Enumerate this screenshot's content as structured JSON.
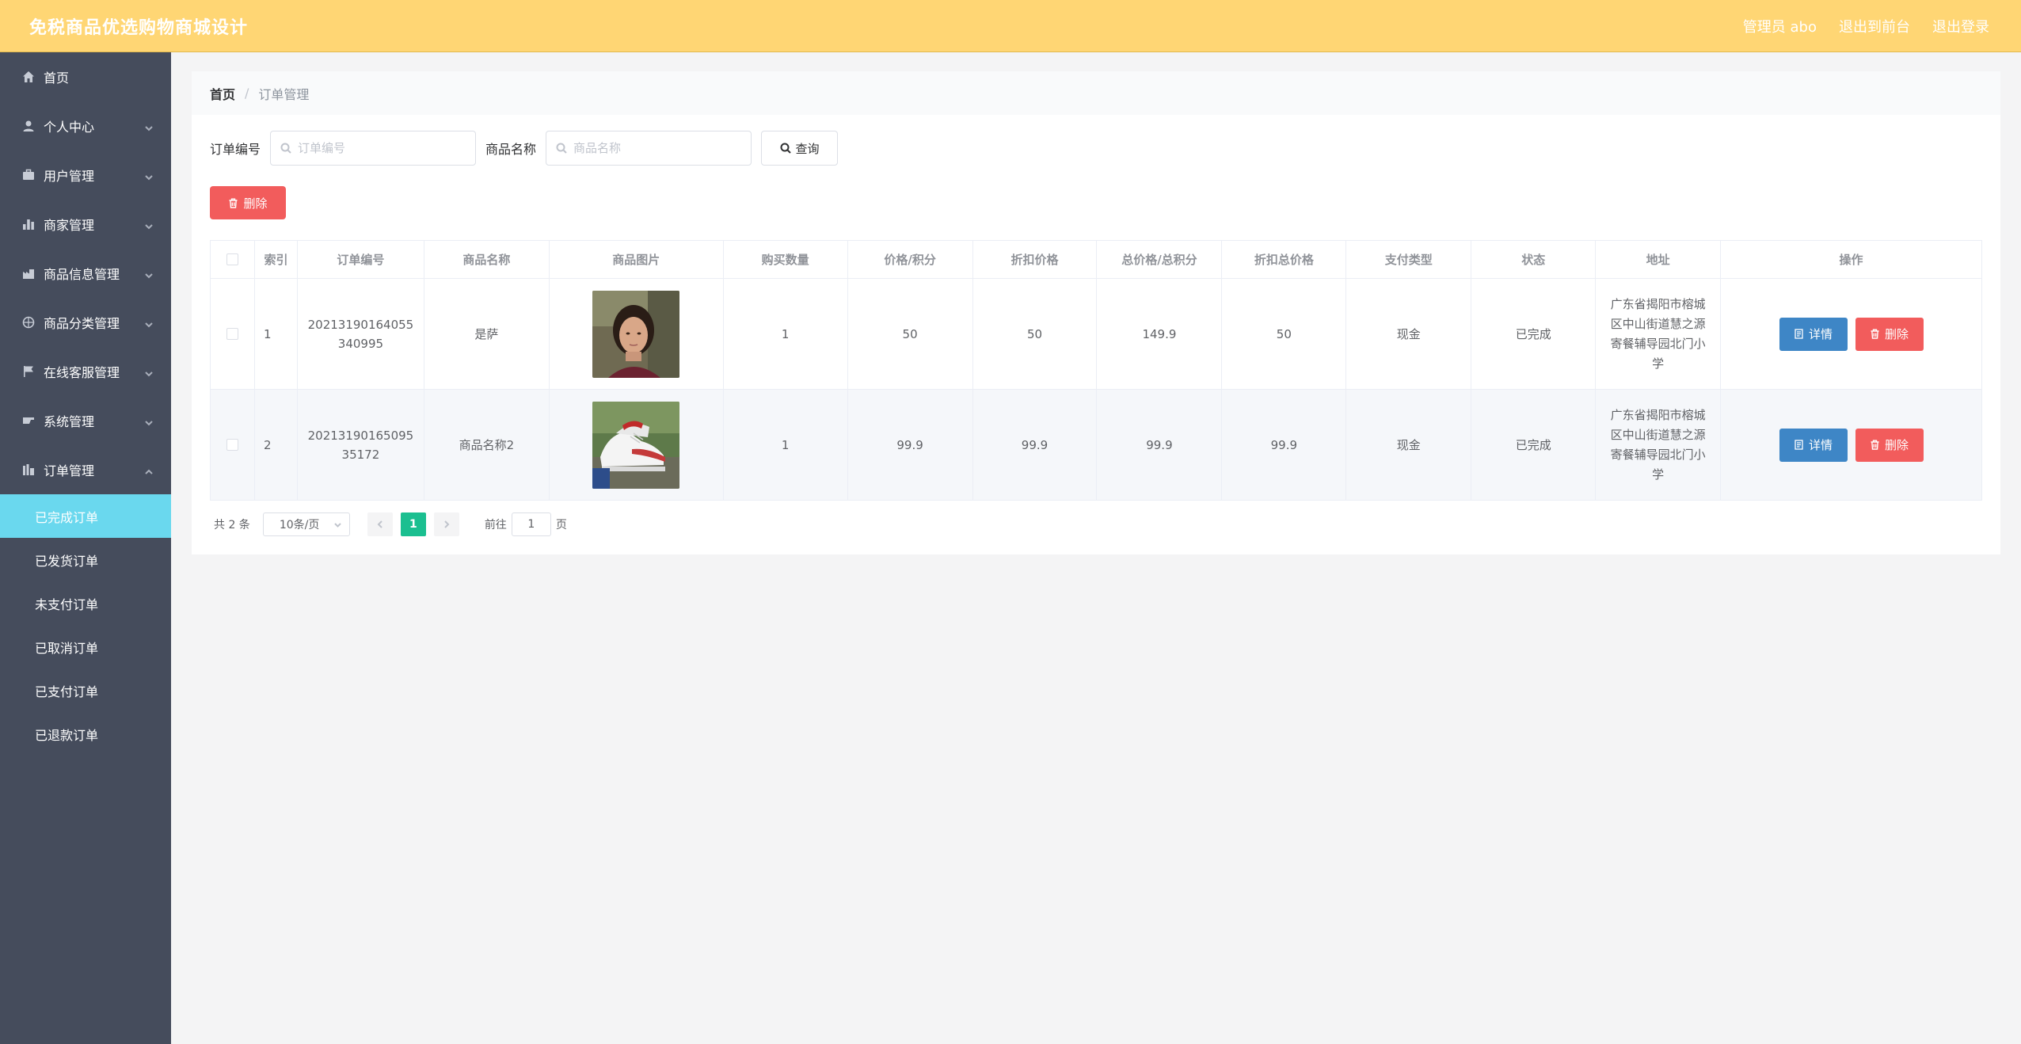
{
  "header": {
    "title": "免税商品优选购物商城设计",
    "admin_label": "管理员 abo",
    "back_to_front": "退出到前台",
    "logout": "退出登录"
  },
  "sidebar": {
    "items": [
      {
        "label": "首页",
        "icon": "home-icon"
      },
      {
        "label": "个人中心",
        "icon": "user-icon"
      },
      {
        "label": "用户管理",
        "icon": "briefcase-icon"
      },
      {
        "label": "商家管理",
        "icon": "bar-chart-icon"
      },
      {
        "label": "商品信息管理",
        "icon": "factory-icon"
      },
      {
        "label": "商品分类管理",
        "icon": "compass-icon"
      },
      {
        "label": "在线客服管理",
        "icon": "flag-icon"
      },
      {
        "label": "系统管理",
        "icon": "settings-icon"
      },
      {
        "label": "订单管理",
        "icon": "orders-icon"
      }
    ],
    "submenu": [
      {
        "label": "已完成订单"
      },
      {
        "label": "已发货订单"
      },
      {
        "label": "未支付订单"
      },
      {
        "label": "已取消订单"
      },
      {
        "label": "已支付订单"
      },
      {
        "label": "已退款订单"
      }
    ]
  },
  "breadcrumb": {
    "home": "首页",
    "separator": "/",
    "current": "订单管理"
  },
  "search": {
    "order_no_label": "订单编号",
    "order_no_placeholder": "订单编号",
    "product_name_label": "商品名称",
    "product_name_placeholder": "商品名称",
    "query_button": "查询"
  },
  "toolbar": {
    "delete_button": "删除"
  },
  "table": {
    "headers": [
      "索引",
      "订单编号",
      "商品名称",
      "商品图片",
      "购买数量",
      "价格/积分",
      "折扣价格",
      "总价格/总积分",
      "折扣总价格",
      "支付类型",
      "状态",
      "地址",
      "操作"
    ],
    "rows": [
      {
        "index": "1",
        "order_no": "20213190164055340995",
        "product_name": "是萨",
        "image": "portrait-photo",
        "quantity": "1",
        "price": "50",
        "discount_price": "50",
        "total_price": "149.9",
        "discount_total": "50",
        "pay_type": "现金",
        "status": "已完成",
        "address": "广东省揭阳市榕城区中山街道慧之源寄餐辅导园北门小学",
        "detail_button": "详情",
        "delete_button": "删除"
      },
      {
        "index": "2",
        "order_no": "2021319016509535172",
        "product_name": "商品名称2",
        "image": "sneaker-photo",
        "quantity": "1",
        "price": "99.9",
        "discount_price": "99.9",
        "total_price": "99.9",
        "discount_total": "99.9",
        "pay_type": "现金",
        "status": "已完成",
        "address": "广东省揭阳市榕城区中山街道慧之源寄餐辅导园北门小学",
        "detail_button": "详情",
        "delete_button": "删除"
      }
    ]
  },
  "pagination": {
    "total": "共 2 条",
    "page_size": "10条/页",
    "current_page": "1",
    "goto_prefix": "前往",
    "goto_value": "1",
    "goto_suffix": "页"
  },
  "colors": {
    "header_bg": "#ffd674",
    "sidebar_bg": "#454c5c",
    "active_submenu": "#6ad8ee",
    "danger": "#f25c5c",
    "primary": "#3e86c6",
    "page_active": "#1bbf90"
  }
}
